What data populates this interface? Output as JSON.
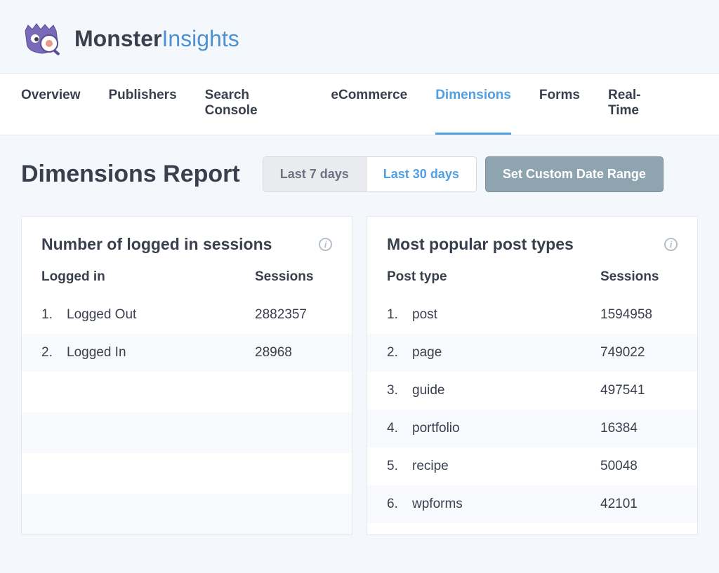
{
  "brand": {
    "part1": "Monster",
    "part2": "Insights"
  },
  "nav": {
    "items": [
      {
        "label": "Overview"
      },
      {
        "label": "Publishers"
      },
      {
        "label": "Search Console"
      },
      {
        "label": "eCommerce"
      },
      {
        "label": "Dimensions",
        "active": true
      },
      {
        "label": "Forms"
      },
      {
        "label": "Real-Time"
      }
    ]
  },
  "page": {
    "title": "Dimensions Report",
    "range7": "Last 7 days",
    "range30": "Last 30 days",
    "custom_range": "Set Custom Date Range"
  },
  "cards": [
    {
      "title": "Number of logged in sessions",
      "col_label": "Logged in",
      "col_value": "Sessions",
      "rows": [
        {
          "ord": "1.",
          "label": "Logged Out",
          "value": "2882357"
        },
        {
          "ord": "2.",
          "label": "Logged In",
          "value": "28968"
        }
      ]
    },
    {
      "title": "Most popular post types",
      "col_label": "Post type",
      "col_value": "Sessions",
      "rows": [
        {
          "ord": "1.",
          "label": "post",
          "value": "1594958"
        },
        {
          "ord": "2.",
          "label": "page",
          "value": "749022"
        },
        {
          "ord": "3.",
          "label": "guide",
          "value": "497541"
        },
        {
          "ord": "4.",
          "label": "portfolio",
          "value": "16384"
        },
        {
          "ord": "5.",
          "label": "recipe",
          "value": "50048"
        },
        {
          "ord": "6.",
          "label": "wpforms",
          "value": "42101"
        }
      ]
    }
  ]
}
